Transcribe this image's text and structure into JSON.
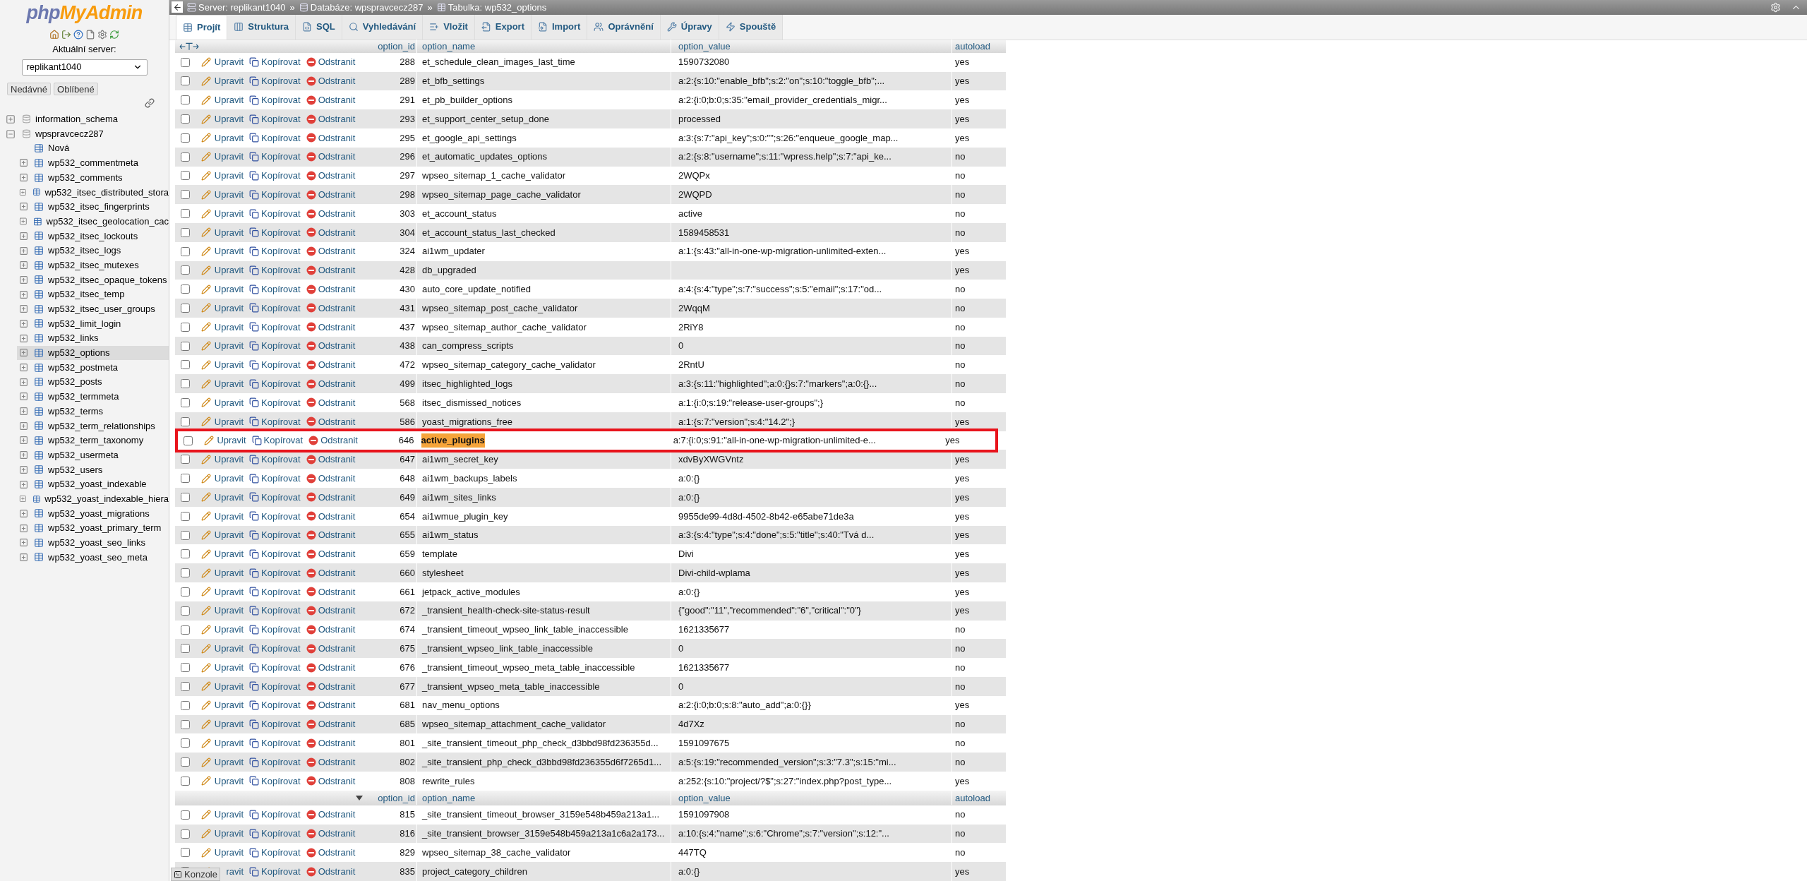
{
  "sidebar": {
    "logo": {
      "part1": "php",
      "part2": "MyAdmin"
    },
    "server_label": "Aktuální server:",
    "server_select": {
      "value": "replikant1040"
    },
    "buttons": [
      "Nedávné",
      "Oblíbené"
    ],
    "tree": [
      {
        "label": "information_schema",
        "expanded": false
      },
      {
        "label": "wpspravcecz287",
        "expanded": true,
        "children": [
          {
            "label": "Nová",
            "kind": "new",
            "selected": false
          },
          {
            "label": "wp532_commentmeta",
            "kind": "table",
            "selected": false
          },
          {
            "label": "wp532_comments",
            "kind": "table",
            "selected": false
          },
          {
            "label": "wp532_itsec_distributed_stora",
            "kind": "table",
            "selected": false
          },
          {
            "label": "wp532_itsec_fingerprints",
            "kind": "table",
            "selected": false
          },
          {
            "label": "wp532_itsec_geolocation_cac",
            "kind": "table",
            "selected": false
          },
          {
            "label": "wp532_itsec_lockouts",
            "kind": "table",
            "selected": false
          },
          {
            "label": "wp532_itsec_logs",
            "kind": "table",
            "selected": false
          },
          {
            "label": "wp532_itsec_mutexes",
            "kind": "table",
            "selected": false
          },
          {
            "label": "wp532_itsec_opaque_tokens",
            "kind": "table",
            "selected": false
          },
          {
            "label": "wp532_itsec_temp",
            "kind": "table",
            "selected": false
          },
          {
            "label": "wp532_itsec_user_groups",
            "kind": "table",
            "selected": false
          },
          {
            "label": "wp532_limit_login",
            "kind": "table",
            "selected": false
          },
          {
            "label": "wp532_links",
            "kind": "table",
            "selected": false
          },
          {
            "label": "wp532_options",
            "kind": "table",
            "selected": true
          },
          {
            "label": "wp532_postmeta",
            "kind": "table",
            "selected": false
          },
          {
            "label": "wp532_posts",
            "kind": "table",
            "selected": false
          },
          {
            "label": "wp532_termmeta",
            "kind": "table",
            "selected": false
          },
          {
            "label": "wp532_terms",
            "kind": "table",
            "selected": false
          },
          {
            "label": "wp532_term_relationships",
            "kind": "table",
            "selected": false
          },
          {
            "label": "wp532_term_taxonomy",
            "kind": "table",
            "selected": false
          },
          {
            "label": "wp532_usermeta",
            "kind": "table",
            "selected": false
          },
          {
            "label": "wp532_users",
            "kind": "table",
            "selected": false
          },
          {
            "label": "wp532_yoast_indexable",
            "kind": "table",
            "selected": false
          },
          {
            "label": "wp532_yoast_indexable_hiera",
            "kind": "table",
            "selected": false
          },
          {
            "label": "wp532_yoast_migrations",
            "kind": "table",
            "selected": false
          },
          {
            "label": "wp532_yoast_primary_term",
            "kind": "table",
            "selected": false
          },
          {
            "label": "wp532_yoast_seo_links",
            "kind": "table",
            "selected": false
          },
          {
            "label": "wp532_yoast_seo_meta",
            "kind": "table",
            "selected": false
          }
        ]
      }
    ]
  },
  "breadcrumbs": [
    {
      "label": "Server: replikant1040",
      "sep": "»"
    },
    {
      "label": "Databáze: wpspravcecz287",
      "sep": "»"
    },
    {
      "label": "Tabulka: wp532_options"
    }
  ],
  "tabs": [
    {
      "label": "Projít",
      "selected": true
    },
    {
      "label": "Struktura",
      "selected": false
    },
    {
      "label": "SQL",
      "selected": false
    },
    {
      "label": "Vyhledávání",
      "selected": false
    },
    {
      "label": "Vložit",
      "selected": false
    },
    {
      "label": "Export",
      "selected": false
    },
    {
      "label": "Import",
      "selected": false
    },
    {
      "label": "Oprávnění",
      "selected": false
    },
    {
      "label": "Úpravy",
      "selected": false
    },
    {
      "label": "Spouště",
      "selected": false
    }
  ],
  "table": {
    "body": [
      {
        "kind": "header",
        "sort_indicator": false,
        "labels": [
          "option_id",
          "option_name",
          "option_value",
          "autoload"
        ]
      },
      {
        "kind": "row",
        "id": "288",
        "name": "et_schedule_clean_images_last_time",
        "value": "1590732080",
        "autoload": "yes",
        "actions": [
          "Upravit",
          "Kopírovat",
          "Odstranit"
        ],
        "checked": false,
        "match": false,
        "boxed": false
      },
      {
        "kind": "row",
        "id": "289",
        "name": "et_bfb_settings",
        "value": "a:2:{s:10:\"enable_bfb\";s:2:\"on\";s:10:\"toggle_bfb\";...",
        "autoload": "yes",
        "actions": [
          "Upravit",
          "Kopírovat",
          "Odstranit"
        ],
        "checked": false,
        "match": false,
        "boxed": false
      },
      {
        "kind": "row",
        "id": "291",
        "name": "et_pb_builder_options",
        "value": "a:2:{i:0;b:0;s:35:\"email_provider_credentials_migr...",
        "autoload": "yes",
        "actions": [
          "Upravit",
          "Kopírovat",
          "Odstranit"
        ],
        "checked": false,
        "match": false,
        "boxed": false
      },
      {
        "kind": "row",
        "id": "293",
        "name": "et_support_center_setup_done",
        "value": "processed",
        "autoload": "yes",
        "actions": [
          "Upravit",
          "Kopírovat",
          "Odstranit"
        ],
        "checked": false,
        "match": false,
        "boxed": false
      },
      {
        "kind": "row",
        "id": "295",
        "name": "et_google_api_settings",
        "value": "a:3:{s:7:\"api_key\";s:0:\"\";s:26:\"enqueue_google_map...",
        "autoload": "yes",
        "actions": [
          "Upravit",
          "Kopírovat",
          "Odstranit"
        ],
        "checked": false,
        "match": false,
        "boxed": false
      },
      {
        "kind": "row",
        "id": "296",
        "name": "et_automatic_updates_options",
        "value": "a:2:{s:8:\"username\";s:11:\"wpress.help\";s:7:\"api_ke...",
        "autoload": "no",
        "actions": [
          "Upravit",
          "Kopírovat",
          "Odstranit"
        ],
        "checked": false,
        "match": false,
        "boxed": false
      },
      {
        "kind": "row",
        "id": "297",
        "name": "wpseo_sitemap_1_cache_validator",
        "value": "2WQPx",
        "autoload": "no",
        "actions": [
          "Upravit",
          "Kopírovat",
          "Odstranit"
        ],
        "checked": false,
        "match": false,
        "boxed": false
      },
      {
        "kind": "row",
        "id": "298",
        "name": "wpseo_sitemap_page_cache_validator",
        "value": "2WQPD",
        "autoload": "no",
        "actions": [
          "Upravit",
          "Kopírovat",
          "Odstranit"
        ],
        "checked": false,
        "match": false,
        "boxed": false
      },
      {
        "kind": "row",
        "id": "303",
        "name": "et_account_status",
        "value": "active",
        "autoload": "no",
        "actions": [
          "Upravit",
          "Kopírovat",
          "Odstranit"
        ],
        "checked": false,
        "match": false,
        "boxed": false
      },
      {
        "kind": "row",
        "id": "304",
        "name": "et_account_status_last_checked",
        "value": "1589458531",
        "autoload": "no",
        "actions": [
          "Upravit",
          "Kopírovat",
          "Odstranit"
        ],
        "checked": false,
        "match": false,
        "boxed": false
      },
      {
        "kind": "row",
        "id": "324",
        "name": "ai1wm_updater",
        "value": "a:1:{s:43:\"all-in-one-wp-migration-unlimited-exten...",
        "autoload": "yes",
        "actions": [
          "Upravit",
          "Kopírovat",
          "Odstranit"
        ],
        "checked": false,
        "match": false,
        "boxed": false
      },
      {
        "kind": "row",
        "id": "428",
        "name": "db_upgraded",
        "autoload": "yes",
        "actions": [
          "Upravit",
          "Kopírovat",
          "Odstranit"
        ],
        "checked": false,
        "match": false,
        "boxed": false
      },
      {
        "kind": "row",
        "id": "430",
        "name": "auto_core_update_notified",
        "value": "a:4:{s:4:\"type\";s:7:\"success\";s:5:\"email\";s:17:\"od...",
        "autoload": "no",
        "actions": [
          "Upravit",
          "Kopírovat",
          "Odstranit"
        ],
        "checked": false,
        "match": false,
        "boxed": false
      },
      {
        "kind": "row",
        "id": "431",
        "name": "wpseo_sitemap_post_cache_validator",
        "value": "2WqqM",
        "autoload": "no",
        "actions": [
          "Upravit",
          "Kopírovat",
          "Odstranit"
        ],
        "checked": false,
        "match": false,
        "boxed": false
      },
      {
        "kind": "row",
        "id": "437",
        "name": "wpseo_sitemap_author_cache_validator",
        "value": "2RiY8",
        "autoload": "no",
        "actions": [
          "Upravit",
          "Kopírovat",
          "Odstranit"
        ],
        "checked": false,
        "match": false,
        "boxed": false
      },
      {
        "kind": "row",
        "id": "438",
        "name": "can_compress_scripts",
        "value": "0",
        "autoload": "no",
        "actions": [
          "Upravit",
          "Kopírovat",
          "Odstranit"
        ],
        "checked": false,
        "match": false,
        "boxed": false
      },
      {
        "kind": "row",
        "id": "472",
        "name": "wpseo_sitemap_category_cache_validator",
        "value": "2RntU",
        "autoload": "no",
        "actions": [
          "Upravit",
          "Kopírovat",
          "Odstranit"
        ],
        "checked": false,
        "match": false,
        "boxed": false
      },
      {
        "kind": "row",
        "id": "499",
        "name": "itsec_highlighted_logs",
        "value": "a:3:{s:11:\"highlighted\";a:0:{}s:7:\"markers\";a:0:{}...",
        "autoload": "no",
        "actions": [
          "Upravit",
          "Kopírovat",
          "Odstranit"
        ],
        "checked": false,
        "match": false,
        "boxed": false
      },
      {
        "kind": "row",
        "id": "568",
        "name": "itsec_dismissed_notices",
        "value": "a:1:{i:0;s:19:\"release-user-groups\";}",
        "autoload": "no",
        "actions": [
          "Upravit",
          "Kopírovat",
          "Odstranit"
        ],
        "checked": false,
        "match": false,
        "boxed": false
      },
      {
        "kind": "row",
        "id": "586",
        "name": "yoast_migrations_free",
        "value": "a:1:{s:7:\"version\";s:4:\"14.2\";}",
        "autoload": "yes",
        "actions": [
          "Upravit",
          "Kopírovat",
          "Odstranit"
        ],
        "checked": false,
        "match": false,
        "boxed": false
      },
      {
        "kind": "row",
        "id": "646",
        "name": "active_plugins",
        "value": "a:7:{i:0;s:91:\"all-in-one-wp-migration-unlimited-e...",
        "autoload": "yes",
        "actions": [
          "Upravit",
          "Kopírovat",
          "Odstranit"
        ],
        "checked": false,
        "match": true,
        "boxed": true
      },
      {
        "kind": "row",
        "id": "647",
        "name": "ai1wm_secret_key",
        "value": "xdvByXWGVntz",
        "autoload": "yes",
        "actions": [
          "Upravit",
          "Kopírovat",
          "Odstranit"
        ],
        "checked": false,
        "match": false,
        "boxed": false
      },
      {
        "kind": "row",
        "id": "648",
        "name": "ai1wm_backups_labels",
        "value": "a:0:{}",
        "autoload": "yes",
        "actions": [
          "Upravit",
          "Kopírovat",
          "Odstranit"
        ],
        "checked": false,
        "match": false,
        "boxed": false
      },
      {
        "kind": "row",
        "id": "649",
        "name": "ai1wm_sites_links",
        "value": "a:0:{}",
        "autoload": "yes",
        "actions": [
          "Upravit",
          "Kopírovat",
          "Odstranit"
        ],
        "checked": false,
        "match": false,
        "boxed": false
      },
      {
        "kind": "row",
        "id": "654",
        "name": "ai1wmue_plugin_key",
        "value": "9955de99-4d8d-4502-8b42-e65abe71de3a",
        "autoload": "yes",
        "actions": [
          "Upravit",
          "Kopírovat",
          "Odstranit"
        ],
        "checked": false,
        "match": false,
        "boxed": false
      },
      {
        "kind": "row",
        "id": "655",
        "name": "ai1wm_status",
        "value": "a:3:{s:4:\"type\";s:4:\"done\";s:5:\"title\";s:40:\"Tvá d...",
        "autoload": "yes",
        "actions": [
          "Upravit",
          "Kopírovat",
          "Odstranit"
        ],
        "checked": false,
        "match": false,
        "boxed": false
      },
      {
        "kind": "row",
        "id": "659",
        "name": "template",
        "value": "Divi",
        "autoload": "yes",
        "actions": [
          "Upravit",
          "Kopírovat",
          "Odstranit"
        ],
        "checked": false,
        "match": false,
        "boxed": false
      },
      {
        "kind": "row",
        "id": "660",
        "name": "stylesheet",
        "value": "Divi-child-wplama",
        "autoload": "yes",
        "actions": [
          "Upravit",
          "Kopírovat",
          "Odstranit"
        ],
        "checked": false,
        "match": false,
        "boxed": false
      },
      {
        "kind": "row",
        "id": "661",
        "name": "jetpack_active_modules",
        "value": "a:0:{}",
        "autoload": "yes",
        "actions": [
          "Upravit",
          "Kopírovat",
          "Odstranit"
        ],
        "checked": false,
        "match": false,
        "boxed": false
      },
      {
        "kind": "row",
        "id": "672",
        "name": "_transient_health-check-site-status-result",
        "value": "{\"good\":\"11\",\"recommended\":\"6\",\"critical\":\"0\"}",
        "autoload": "yes",
        "actions": [
          "Upravit",
          "Kopírovat",
          "Odstranit"
        ],
        "checked": false,
        "match": false,
        "boxed": false
      },
      {
        "kind": "row",
        "id": "674",
        "name": "_transient_timeout_wpseo_link_table_inaccessible",
        "value": "1621335677",
        "autoload": "no",
        "actions": [
          "Upravit",
          "Kopírovat",
          "Odstranit"
        ],
        "checked": false,
        "match": false,
        "boxed": false
      },
      {
        "kind": "row",
        "id": "675",
        "name": "_transient_wpseo_link_table_inaccessible",
        "value": "0",
        "autoload": "no",
        "actions": [
          "Upravit",
          "Kopírovat",
          "Odstranit"
        ],
        "checked": false,
        "match": false,
        "boxed": false
      },
      {
        "kind": "row",
        "id": "676",
        "name": "_transient_timeout_wpseo_meta_table_inaccessible",
        "value": "1621335677",
        "autoload": "no",
        "actions": [
          "Upravit",
          "Kopírovat",
          "Odstranit"
        ],
        "checked": false,
        "match": false,
        "boxed": false
      },
      {
        "kind": "row",
        "id": "677",
        "name": "_transient_wpseo_meta_table_inaccessible",
        "value": "0",
        "autoload": "no",
        "actions": [
          "Upravit",
          "Kopírovat",
          "Odstranit"
        ],
        "checked": false,
        "match": false,
        "boxed": false
      },
      {
        "kind": "row",
        "id": "681",
        "name": "nav_menu_options",
        "value": "a:2:{i:0;b:0;s:8:\"auto_add\";a:0:{}}",
        "autoload": "yes",
        "actions": [
          "Upravit",
          "Kopírovat",
          "Odstranit"
        ],
        "checked": false,
        "match": false,
        "boxed": false
      },
      {
        "kind": "row",
        "id": "685",
        "name": "wpseo_sitemap_attachment_cache_validator",
        "value": "4d7Xz",
        "autoload": "no",
        "actions": [
          "Upravit",
          "Kopírovat",
          "Odstranit"
        ],
        "checked": false,
        "match": false,
        "boxed": false
      },
      {
        "kind": "row",
        "id": "801",
        "name": "_site_transient_timeout_php_check_d3bbd98fd236355d...",
        "value": "1591097675",
        "autoload": "no",
        "actions": [
          "Upravit",
          "Kopírovat",
          "Odstranit"
        ],
        "checked": false,
        "match": false,
        "boxed": false
      },
      {
        "kind": "row",
        "id": "802",
        "name": "_site_transient_php_check_d3bbd98fd236355d6f7265d1...",
        "value": "a:5:{s:19:\"recommended_version\";s:3:\"7.3\";s:15:\"mi...",
        "autoload": "no",
        "actions": [
          "Upravit",
          "Kopírovat",
          "Odstranit"
        ],
        "checked": false,
        "match": false,
        "boxed": false
      },
      {
        "kind": "row",
        "id": "808",
        "name": "rewrite_rules",
        "value": "a:252:{s:10:\"project/?$\";s:27:\"index.php?post_type...",
        "autoload": "yes",
        "actions": [
          "Upravit",
          "Kopírovat",
          "Odstranit"
        ],
        "checked": false,
        "match": false,
        "boxed": false
      },
      {
        "kind": "header",
        "sort_indicator": true,
        "labels": [
          "option_id",
          "option_name",
          "option_value",
          "autoload"
        ]
      },
      {
        "kind": "row",
        "id": "815",
        "name": "_site_transient_timeout_browser_3159e548b459a213a1...",
        "value": "1591097908",
        "autoload": "no",
        "actions": [
          "Upravit",
          "Kopírovat",
          "Odstranit"
        ],
        "checked": false,
        "match": false,
        "boxed": false
      },
      {
        "kind": "row",
        "id": "816",
        "name": "_site_transient_browser_3159e548b459a213a1c6a2a173...",
        "value": "a:10:{s:4:\"name\";s:6:\"Chrome\";s:7:\"version\";s:12:\"...",
        "autoload": "no",
        "actions": [
          "Upravit",
          "Kopírovat",
          "Odstranit"
        ],
        "checked": false,
        "match": false,
        "boxed": false
      },
      {
        "kind": "row",
        "id": "829",
        "name": "wpseo_sitemap_38_cache_validator",
        "value": "447TQ",
        "autoload": "no",
        "actions": [
          "Upravit",
          "Kopírovat",
          "Odstranit"
        ],
        "checked": false,
        "match": false,
        "boxed": false
      },
      {
        "kind": "row",
        "id": "835",
        "name": "project_category_children",
        "value": "a:0:{}",
        "autoload": "yes",
        "actions": [
          "ravit",
          "Kopírovat",
          "Odstranit"
        ],
        "checked": false,
        "match": false,
        "boxed": false
      }
    ]
  },
  "console": {
    "label": "Konzole"
  }
}
